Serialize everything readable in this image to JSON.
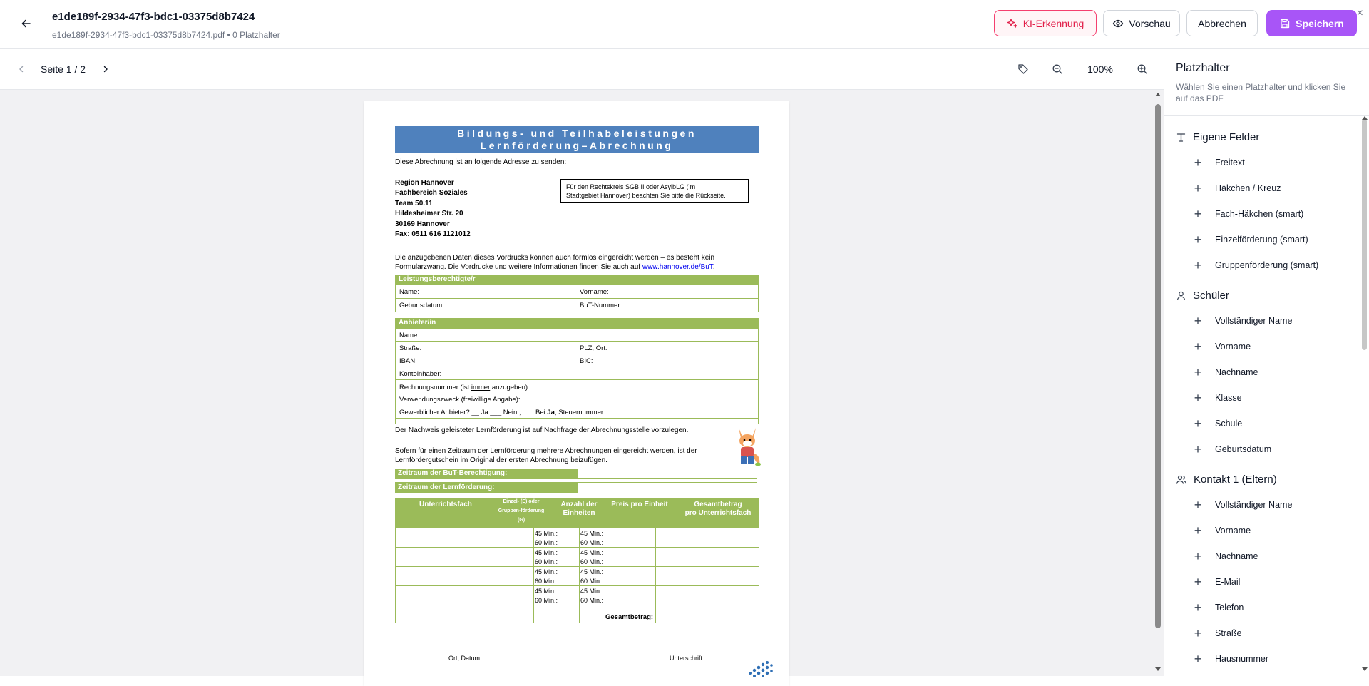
{
  "header": {
    "title": "e1de189f-2934-47f3-bdc1-03375d8b7424",
    "subtitle": "e1de189f-2934-47f3-bdc1-03375d8b7424.pdf • 0 Platzhalter",
    "ki_label": "KI-Erkennung",
    "preview_label": "Vorschau",
    "cancel_label": "Abbrechen",
    "save_label": "Speichern",
    "close_symbol": "×"
  },
  "toolbar": {
    "page_indicator": "Seite 1 / 2",
    "zoom": "100%"
  },
  "pdf": {
    "title_line1": "Bildungs- und Teilhabeleistungen",
    "title_line2": "Lernförderung–Abrechnung",
    "intro": "Diese Abrechnung ist an folgende Adresse zu senden:",
    "address": [
      "Region Hannover",
      "Fachbereich Soziales",
      "Team 50.11",
      "Hildesheimer Str. 20",
      "30169 Hannover",
      "Fax: 0511 616 1121012"
    ],
    "note_box": [
      "Für den Rechtskreis SGB II oder AsylbLG (im",
      "Stadtgebiet Hannover) beachten Sie bitte die Rückseite."
    ],
    "info_line1": "Die anzugebenen Daten dieses Vordrucks können auch formlos eingereicht werden – es besteht kein",
    "info_line2_prefix": "Formularzwang. Die Vordrucke und weitere Informationen finden Sie auch auf",
    "info_link": "www.hannover.de/BuT",
    "info_suffix": ".",
    "sec1_title": "Leistungsberechtigte/r",
    "sec1_name": "Name:",
    "sec1_vorname": "Vorname:",
    "sec1_geb": "Geburtsdatum:",
    "sec1_but": "BuT-Nummer:",
    "sec2_title": "Anbieter/in",
    "sec2_name": "Name:",
    "sec2_strasse": "Straße:",
    "sec2_plz": "PLZ, Ort:",
    "sec2_iban": "IBAN:",
    "sec2_bic": "BIC:",
    "sec2_inhaber": "Kontoinhaber:",
    "sec2_rechnung_a": "Rechnungsnummer (ist",
    "sec2_rechnung_b": "immer",
    "sec2_rechnung_c": "anzugeben):",
    "sec2_zweck": "Verwendungszweck (freiwillige Angabe):",
    "sec2_gewerb": "Gewerblicher Anbieter? __ Ja ___ Nein ;",
    "sec2_steuer_a": "Bei",
    "sec2_steuer_b": "Ja",
    "sec2_steuer_c": ", Steuernummer:",
    "nachweis": "Der Nachweis geleisteter Lernförderung ist auf Nachfrage der Abrechnungsstelle vorzulegen.",
    "zeitraum_text1": "Sofern für einen Zeitraum der Lernförderung mehrere Abrechnungen eingereicht werden, ist der",
    "zeitraum_text2": "Lernfördergutschein im Original der ersten Abrechnung beizufügen.",
    "zeitraum_but": "Zeitraum der BuT-Berechtigung:",
    "zeitraum_lern": "Zeitraum der Lernförderung:",
    "col1": "Unterrichtsfach",
    "col2_a": "Einzel- (E) oder",
    "col2_b": "Gruppen-förderung",
    "col2_c": "(G)",
    "col3_a": "Anzahl der",
    "col3_b": "Einheiten",
    "col4": "Preis pro Einheit",
    "col5_a": "Gesamtbetrag",
    "col5_b": "pro Unterrichtsfach",
    "min45": "45 Min.:",
    "min60": "60 Min.:",
    "gesamt": "Gesamtbetrag:",
    "ort_datum": "Ort, Datum",
    "unterschrift": "Unterschrift"
  },
  "sidebar": {
    "title": "Platzhalter",
    "description": "Wählen Sie einen Platzhalter und klicken Sie auf das PDF",
    "sections": [
      {
        "label": "Eigene Felder",
        "icon": "text-icon",
        "items": [
          "Freitext",
          "Häkchen / Kreuz",
          "Fach-Häkchen (smart)",
          "Einzelförderung (smart)",
          "Gruppenförderung (smart)"
        ]
      },
      {
        "label": "Schüler",
        "icon": "user-icon",
        "items": [
          "Vollständiger Name",
          "Vorname",
          "Nachname",
          "Klasse",
          "Schule",
          "Geburtsdatum"
        ]
      },
      {
        "label": "Kontakt 1 (Eltern)",
        "icon": "users-icon",
        "items": [
          "Vollständiger Name",
          "Vorname",
          "Nachname",
          "E-Mail",
          "Telefon",
          "Straße",
          "Hausnummer"
        ]
      }
    ]
  },
  "colors": {
    "accent": "#a855f7",
    "ki": "#e11d48",
    "pdf_blue": "#4f81bd",
    "pdf_green": "#9bbb59"
  }
}
